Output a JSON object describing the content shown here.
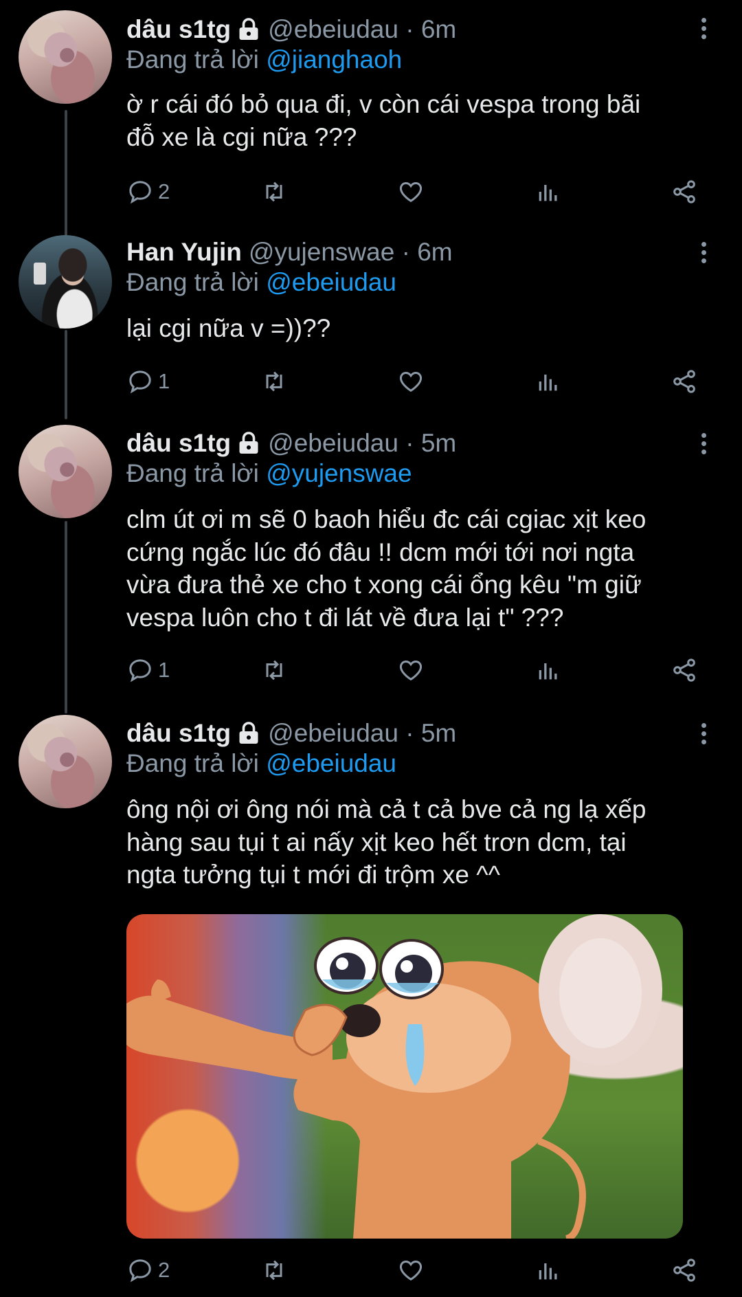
{
  "tweets": [
    {
      "name": "dâu s1tg",
      "locked": true,
      "handle": "@ebeiudau · 6m",
      "reply_label": "Đang trả lời",
      "reply_to": "@jianghaoh",
      "text_lines": [
        "ờ r cái đó bỏ qua đi, v còn cái vespa trong bãi",
        "đỗ xe là cgi nữa ???"
      ],
      "reply_count": "2"
    },
    {
      "name": "Han Yujin",
      "locked": false,
      "handle": "@yujenswae · 6m",
      "reply_label": "Đang trả lời",
      "reply_to": "@ebeiudau",
      "text_lines": [
        "lại cgi nữa v =))??"
      ],
      "reply_count": "1"
    },
    {
      "name": "dâu s1tg",
      "locked": true,
      "handle": "@ebeiudau · 5m",
      "reply_label": "Đang trả lời",
      "reply_to": "@yujenswae",
      "text_lines": [
        "clm út ơi m sẽ 0 baoh hiểu đc cái cgiac xịt keo",
        "cứng ngắc lúc đó đâu !! dcm mới tới nơi ngta",
        "vừa đưa thẻ xe cho t xong cái ổng kêu \"m giữ",
        "vespa luôn cho t đi lát về đưa lại t\" ???"
      ],
      "reply_count": "1"
    },
    {
      "name": "dâu s1tg",
      "locked": true,
      "handle": "@ebeiudau · 5m",
      "reply_label": "Đang trả lời",
      "reply_to": "@ebeiudau",
      "text_lines": [
        "ông nội ơi ông nói mà cả t cả bve cả ng lạ xếp",
        "hàng sau tụi t ai nấy xịt keo hết trơn dcm, tại",
        "ngta tưởng tụi t mới đi trộm xe ^^"
      ],
      "reply_count": "2"
    }
  ],
  "icons": {
    "reply": "reply-icon",
    "retweet": "retweet-icon",
    "like": "heart-icon",
    "views": "views-icon",
    "share": "share-icon",
    "more": "more-vertical-icon",
    "lock": "lock-icon"
  },
  "colors": {
    "background": "#000000",
    "text": "#e7e9ea",
    "secondary": "#8b98a5",
    "link": "#1d9bf0"
  }
}
